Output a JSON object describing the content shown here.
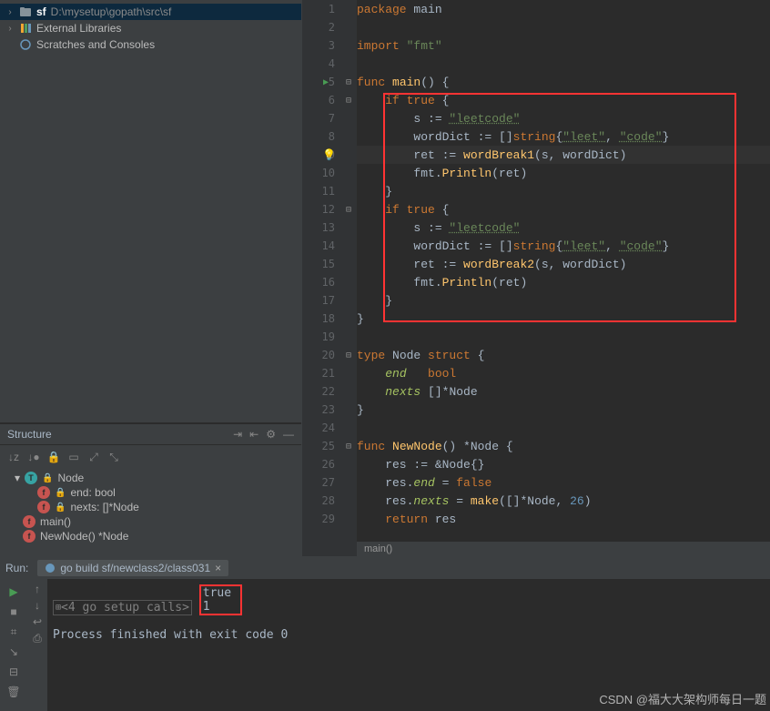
{
  "project": {
    "root_name": "sf",
    "root_path": "D:\\mysetup\\gopath\\src\\sf",
    "ext_libs_label": "External Libraries",
    "scratches_label": "Scratches and Consoles"
  },
  "structure": {
    "title": "Structure",
    "items": [
      {
        "badge": "t",
        "lock": true,
        "label": "Node",
        "indent": 1,
        "chev": "▾"
      },
      {
        "badge": "f",
        "lock": true,
        "label": "end: bool",
        "indent": 2
      },
      {
        "badge": "f",
        "lock": true,
        "label": "nexts: []*Node",
        "indent": 2
      },
      {
        "badge": "f",
        "lock": false,
        "label": "main()",
        "indent": 1
      },
      {
        "badge": "f",
        "lock": false,
        "label": "NewNode() *Node",
        "indent": 1
      }
    ]
  },
  "editor": {
    "breadcrumb": "main()",
    "lines": [
      {
        "n": 1,
        "tokens": [
          {
            "c": "kw",
            "t": "package "
          },
          {
            "c": "id",
            "t": "main"
          }
        ]
      },
      {
        "n": 2,
        "tokens": []
      },
      {
        "n": 3,
        "tokens": [
          {
            "c": "kw",
            "t": "import "
          },
          {
            "c": "str",
            "t": "\"fmt\""
          }
        ]
      },
      {
        "n": 4,
        "tokens": []
      },
      {
        "n": 5,
        "play": true,
        "fold": "-",
        "tokens": [
          {
            "c": "kw",
            "t": "func "
          },
          {
            "c": "fn",
            "t": "main"
          },
          {
            "c": "id",
            "t": "() {"
          }
        ]
      },
      {
        "n": 6,
        "fold": "-",
        "tokens": [
          {
            "c": "id",
            "t": "    "
          },
          {
            "c": "kw",
            "t": "if true"
          },
          {
            "c": "id",
            "t": " {"
          }
        ]
      },
      {
        "n": 7,
        "tokens": [
          {
            "c": "id",
            "t": "        s := "
          },
          {
            "c": "strsoft",
            "t": "\"leetcode\""
          }
        ]
      },
      {
        "n": 8,
        "tokens": [
          {
            "c": "id",
            "t": "        wordDict := []"
          },
          {
            "c": "kw",
            "t": "string"
          },
          {
            "c": "id",
            "t": "{"
          },
          {
            "c": "strsoft",
            "t": "\"leet\""
          },
          {
            "c": "id",
            "t": ", "
          },
          {
            "c": "strsoft",
            "t": "\"code\""
          },
          {
            "c": "id",
            "t": "}"
          }
        ]
      },
      {
        "n": 9,
        "bulb": true,
        "current": true,
        "tokens": [
          {
            "c": "id",
            "t": "        ret := "
          },
          {
            "c": "fn",
            "t": "wordBreak1"
          },
          {
            "c": "id",
            "t": "(s, wordDict)"
          }
        ]
      },
      {
        "n": 10,
        "tokens": [
          {
            "c": "id",
            "t": "        fmt."
          },
          {
            "c": "fn",
            "t": "Println"
          },
          {
            "c": "id",
            "t": "(ret)"
          }
        ]
      },
      {
        "n": 11,
        "tokens": [
          {
            "c": "id",
            "t": "    }"
          }
        ]
      },
      {
        "n": 12,
        "fold": "-",
        "tokens": [
          {
            "c": "id",
            "t": "    "
          },
          {
            "c": "kw",
            "t": "if true"
          },
          {
            "c": "id",
            "t": " {"
          }
        ]
      },
      {
        "n": 13,
        "tokens": [
          {
            "c": "id",
            "t": "        s := "
          },
          {
            "c": "strsoft",
            "t": "\"leetcode\""
          }
        ]
      },
      {
        "n": 14,
        "tokens": [
          {
            "c": "id",
            "t": "        wordDict := []"
          },
          {
            "c": "kw",
            "t": "string"
          },
          {
            "c": "id",
            "t": "{"
          },
          {
            "c": "strsoft",
            "t": "\"leet\""
          },
          {
            "c": "id",
            "t": ", "
          },
          {
            "c": "strsoft",
            "t": "\"code\""
          },
          {
            "c": "id",
            "t": "}"
          }
        ]
      },
      {
        "n": 15,
        "tokens": [
          {
            "c": "id",
            "t": "        ret := "
          },
          {
            "c": "fn",
            "t": "wordBreak2"
          },
          {
            "c": "id",
            "t": "(s, wordDict)"
          }
        ]
      },
      {
        "n": 16,
        "tokens": [
          {
            "c": "id",
            "t": "        fmt."
          },
          {
            "c": "fn",
            "t": "Println"
          },
          {
            "c": "id",
            "t": "(ret)"
          }
        ]
      },
      {
        "n": 17,
        "tokens": [
          {
            "c": "id",
            "t": "    }"
          }
        ]
      },
      {
        "n": 18,
        "tokens": [
          {
            "c": "id",
            "t": "}"
          }
        ]
      },
      {
        "n": 19,
        "tokens": []
      },
      {
        "n": 20,
        "fold": "-",
        "tokens": [
          {
            "c": "kw",
            "t": "type "
          },
          {
            "c": "id",
            "t": "Node "
          },
          {
            "c": "kw",
            "t": "struct"
          },
          {
            "c": "id",
            "t": " {"
          }
        ]
      },
      {
        "n": 21,
        "tokens": [
          {
            "c": "id",
            "t": "    "
          },
          {
            "c": "fldgrey",
            "t": "end"
          },
          {
            "c": "id",
            "t": "   "
          },
          {
            "c": "kw",
            "t": "bool"
          }
        ]
      },
      {
        "n": 22,
        "tokens": [
          {
            "c": "id",
            "t": "    "
          },
          {
            "c": "fldgrey",
            "t": "nexts"
          },
          {
            "c": "id",
            "t": " []*Node"
          }
        ]
      },
      {
        "n": 23,
        "tokens": [
          {
            "c": "id",
            "t": "}"
          }
        ]
      },
      {
        "n": 24,
        "tokens": []
      },
      {
        "n": 25,
        "fold": "-",
        "tokens": [
          {
            "c": "kw",
            "t": "func "
          },
          {
            "c": "fn",
            "t": "NewNode"
          },
          {
            "c": "id",
            "t": "() *Node {"
          }
        ]
      },
      {
        "n": 26,
        "tokens": [
          {
            "c": "id",
            "t": "    res := &Node{}"
          }
        ]
      },
      {
        "n": 27,
        "tokens": [
          {
            "c": "id",
            "t": "    res."
          },
          {
            "c": "fldgrey",
            "t": "end"
          },
          {
            "c": "id",
            "t": " = "
          },
          {
            "c": "kw",
            "t": "false"
          }
        ]
      },
      {
        "n": 28,
        "tokens": [
          {
            "c": "id",
            "t": "    res."
          },
          {
            "c": "fldgrey",
            "t": "nexts"
          },
          {
            "c": "id",
            "t": " = "
          },
          {
            "c": "fn",
            "t": "make"
          },
          {
            "c": "id",
            "t": "([]*Node, "
          },
          {
            "c": "num",
            "t": "26"
          },
          {
            "c": "id",
            "t": ")"
          }
        ]
      },
      {
        "n": 29,
        "tokens": [
          {
            "c": "id",
            "t": "    "
          },
          {
            "c": "kw",
            "t": "return"
          },
          {
            "c": "id",
            "t": " res"
          }
        ]
      }
    ]
  },
  "run": {
    "label": "Run:",
    "tab_label": "go build sf/newclass2/class031",
    "setup_calls": "<4 go setup calls>",
    "output": [
      "true",
      "1"
    ],
    "exit_msg": "Process finished with exit code 0"
  },
  "watermark": "CSDN @福大大架构师每日一题"
}
